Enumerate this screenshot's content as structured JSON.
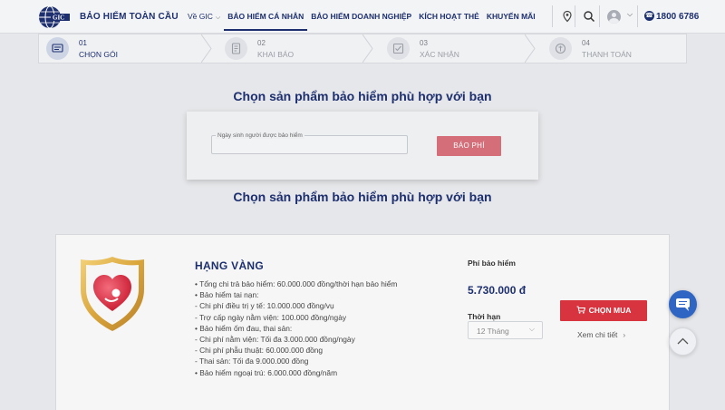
{
  "header": {
    "logo_text": "GIC",
    "brand_name": "BẢO HIỂM TOÀN CẦU",
    "nav": [
      {
        "label": "Về GIC",
        "has_caret": true
      },
      {
        "label": "BẢO HIỂM CÁ NHÂN",
        "active": true
      },
      {
        "label": "BẢO HIỂM DOANH NGHIỆP"
      },
      {
        "label": "KÍCH HOẠT THẺ"
      },
      {
        "label": "KHUYẾN MÃI"
      }
    ],
    "icons": [
      "location-pin-icon",
      "search-icon",
      "user-avatar-icon",
      "phone-icon"
    ],
    "hotline": "1800 6786"
  },
  "stepper": {
    "steps": [
      {
        "num": "01",
        "label": "CHỌN GÓI",
        "icon": "package-icon"
      },
      {
        "num": "02",
        "label": "KHAI BÁO",
        "icon": "form-icon"
      },
      {
        "num": "03",
        "label": "XÁC NHẬN",
        "icon": "confirm-icon"
      },
      {
        "num": "04",
        "label": "THANH TOÁN",
        "icon": "payment-icon"
      }
    ],
    "active_step": 1
  },
  "main": {
    "title": "Chọn sản phẩm bảo hiểm phù hợp với bạn",
    "title_repeat": "Chọn sản phẩm bảo hiểm phù hợp với bạn",
    "form": {
      "dob_label": "Ngày sinh người được bảo hiểm",
      "dob_value": "",
      "quote_button": "BÁO PHÍ"
    }
  },
  "product": {
    "name": "HẠNG VÀNG",
    "benefits": [
      "• Tổng chi trả bảo hiểm: 60.000.000 đồng/thời hạn bảo hiểm",
      "• Bảo hiểm tai nạn:",
      "- Chi phí điều trị y tế: 10.000.000 đồng/vụ",
      "- Trợ cấp ngày nằm viện: 100.000 đồng/ngày",
      "• Bảo hiểm ốm đau, thai sản:",
      "- Chi phí nằm viện: Tối đa 3.000.000 đồng/ngày",
      "- Chi phí phẫu thuật: 60.000.000 đồng",
      "- Thai sản: Tối đa 9.000.000 đồng",
      "• Bảo hiểm ngoại trú: 6.000.000 đồng/năm"
    ],
    "fee_label": "Phí bảo hiểm",
    "fee_value": "5.730.000 đ",
    "term_label": "Thời hạn",
    "term_value": "12 Tháng",
    "buy_button": "CHỌN MUA",
    "details_link": "Xem chi tiết"
  },
  "colors": {
    "brand": "#1d2f6f",
    "buy_button": "#d7343f",
    "quote_button": "#d46e78",
    "chat_button": "#2f66c4"
  }
}
